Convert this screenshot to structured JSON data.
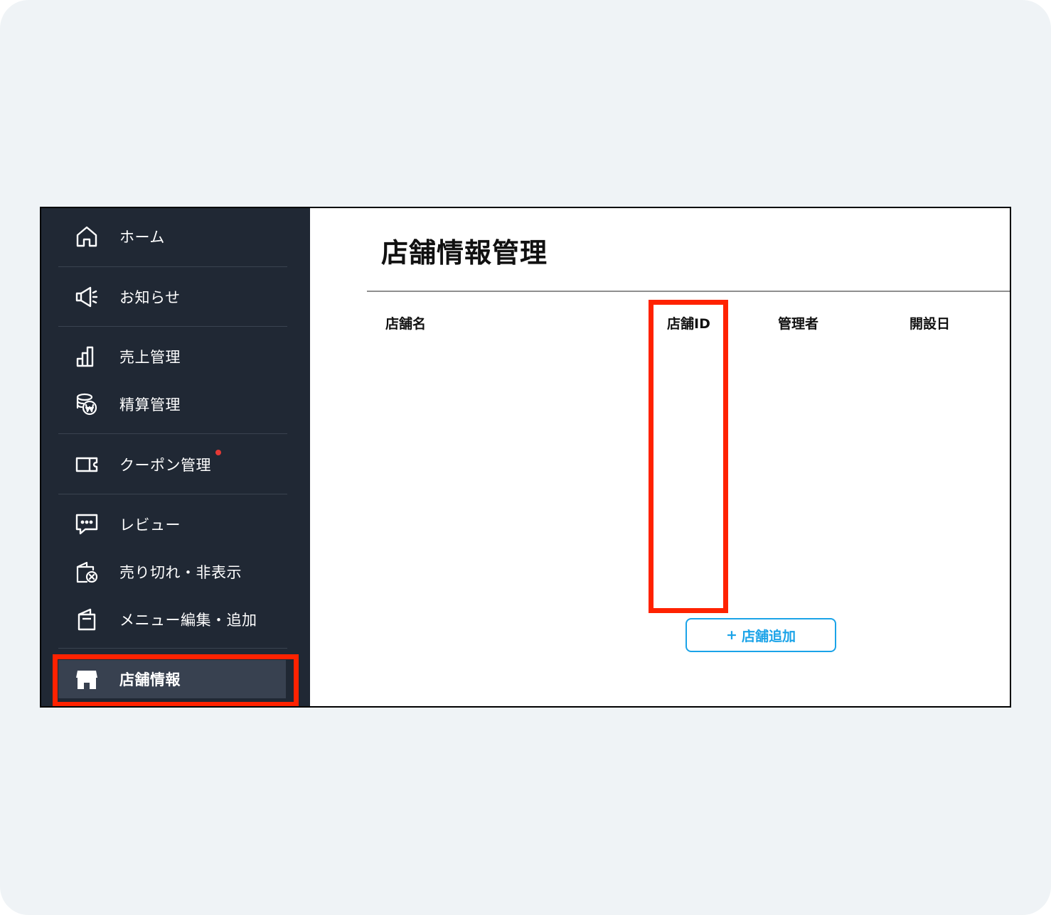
{
  "sidebar": {
    "items": [
      {
        "label": "ホーム",
        "icon": "home-icon"
      },
      {
        "label": "お知らせ",
        "icon": "megaphone-icon"
      },
      {
        "label": "売上管理",
        "icon": "bar-chart-icon"
      },
      {
        "label": "精算管理",
        "icon": "settlement-icon"
      },
      {
        "label": "クーポン管理",
        "icon": "coupon-icon"
      },
      {
        "label": "レビュー",
        "icon": "review-chat-icon"
      },
      {
        "label": "売り切れ・非表示",
        "icon": "sold-out-icon"
      },
      {
        "label": "メニュー編集・追加",
        "icon": "menu-book-icon"
      },
      {
        "label": "店舗情報",
        "icon": "store-icon",
        "active": true
      }
    ]
  },
  "main": {
    "title": "店舗情報管理",
    "columns": [
      "店舗名",
      "店舗ID",
      "管理者",
      "開設日"
    ],
    "add_button": {
      "plus": "+",
      "label": "店舗追加"
    }
  },
  "colors": {
    "sidebar_bg": "#202834",
    "highlight": "#ff2200",
    "accent": "#1aa3e8",
    "badge": "#e53935"
  }
}
